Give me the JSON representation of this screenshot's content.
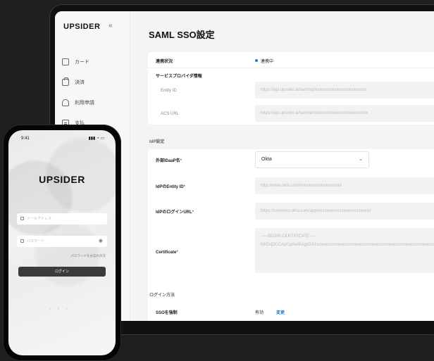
{
  "sidebar": {
    "logo": "UPSIDER",
    "collapse_icon": "«",
    "items": [
      {
        "label": "カード",
        "icon": "card-icon"
      },
      {
        "label": "決済",
        "icon": "bag-icon"
      },
      {
        "label": "利用申請",
        "icon": "person-icon"
      },
      {
        "label": "支払",
        "icon": "document-icon"
      }
    ]
  },
  "main": {
    "title": "SAML SSO設定",
    "status_label": "連携状況",
    "status_value": "連携中",
    "sp_section_label": "サービスプロバイダ情報",
    "entity_id_label": "Entity ID",
    "entity_id_value": "https://api.upsider.ai/saml/sp/xxxxxxxxxxxxxxxxxxxxxxxx",
    "acs_url_label": "ACS URL",
    "acs_url_value": "https://api.upsider.ai/saml/acs/xxxxxxxxxxxxxxxxxxxxxxxx",
    "idp_section_label": "IdP設定",
    "idp_name_label": "外部IDaaP名",
    "idp_name_value": "Okta",
    "idp_entity_label": "IdPのEntity ID",
    "idp_entity_value": "http://www.okta.com/xxxxxxxxxxxxxxxxxxxx",
    "idp_login_url_label": "IdPのログインURL",
    "idp_login_url_value": "https://xxxxxxxx.okta.com/app/xxxxxxxxxxxxxxxxxxxxxxxxx",
    "certificate_label": "Certificate",
    "certificate_value": "-----BEGIN CERTIFICATE----- MIIDqDCCApCgAwIBAgIGAXxxxxxxxxxxxxxxxxxxxxxxxxxxxxxxxxxxxxxxxxxxxxxxxxxxxxxxxxxxxxxxxxxxxxxxxxxxxxxxxxxxxxxxxxxxxxxxxxxxxxxxxxxxxxxxxxxxxxxxxxxxx",
    "login_section_label": "ログイン方法",
    "sso_force_label": "SSOを強制",
    "sso_force_value": "有効",
    "change_link": "変更",
    "required_mark": "*",
    "select_chevron": "⌄"
  },
  "phone": {
    "time": "9:41",
    "signal": "▮▮▮ ◔ ▭",
    "logo": "UPSIDER",
    "email_placeholder": "メールアドレス",
    "password_placeholder": "パスワード",
    "eye_icon": "◉",
    "forgot_link": "パスワードをお忘れの方",
    "login_button": "ログイン",
    "page_dots": "• • •"
  }
}
